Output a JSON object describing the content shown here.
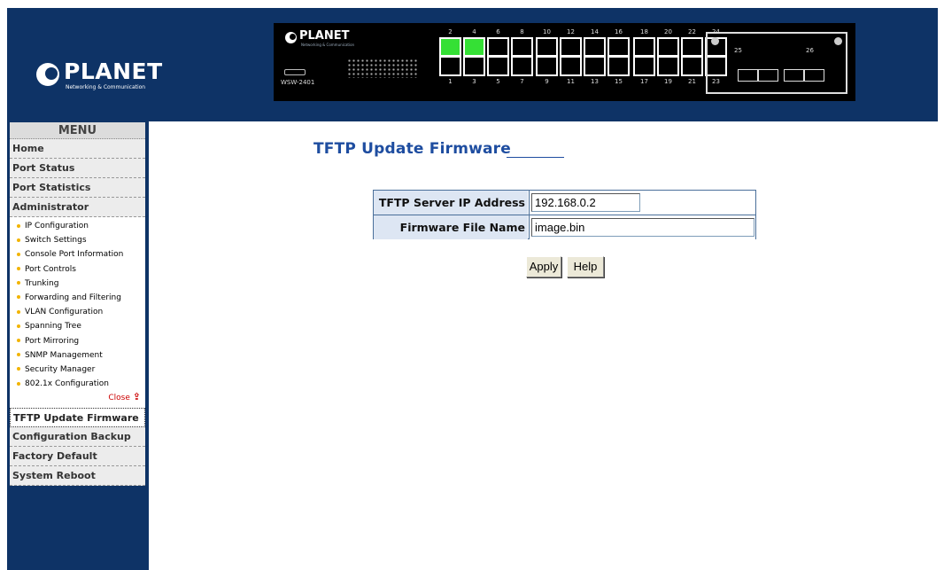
{
  "header": {
    "logo_text": "PLANET",
    "logo_tagline": "Networking & Communication",
    "device": {
      "brand": "PLANET",
      "brand_tagline": "Networking & Communication",
      "model": "WSW-2401",
      "ports_top": [
        "2",
        "4",
        "6",
        "8",
        "10",
        "12",
        "14",
        "16",
        "18",
        "20",
        "22",
        "24"
      ],
      "ports_bottom": [
        "1",
        "3",
        "5",
        "7",
        "9",
        "11",
        "13",
        "15",
        "17",
        "19",
        "21",
        "23"
      ],
      "active_ports": [
        "2",
        "4"
      ],
      "sfp_ports": [
        "25",
        "26"
      ],
      "active_color": "#35e035"
    }
  },
  "sidebar": {
    "title": "MENU",
    "items_top": [
      "Home",
      "Port Status",
      "Port Statistics",
      "Administrator"
    ],
    "admin_subitems": [
      "IP Configuration",
      "Switch Settings",
      "Console Port Information",
      "Port Controls",
      "Trunking",
      "Forwarding and Filtering",
      "VLAN Configuration",
      "Spanning Tree",
      "Port Mirroring",
      "SNMP Management",
      "Security Manager",
      "802.1x Configuration"
    ],
    "close_label": "Close",
    "items_bottom": [
      "TFTP Update Firmware",
      "Configuration Backup",
      "Factory Default",
      "System Reboot"
    ],
    "active_item": "TFTP Update Firmware"
  },
  "main": {
    "title": "TFTP Update Firmware",
    "form": {
      "server_ip_label": "TFTP Server IP Address",
      "server_ip_value": "192.168.0.2",
      "file_name_label": "Firmware File Name",
      "file_name_value": "image.bin"
    },
    "apply_label": "Apply",
    "help_label": "Help"
  },
  "colors": {
    "header_bg": "#0e3366",
    "title_color": "#1e4da0",
    "label_bg": "#dde6f3"
  }
}
